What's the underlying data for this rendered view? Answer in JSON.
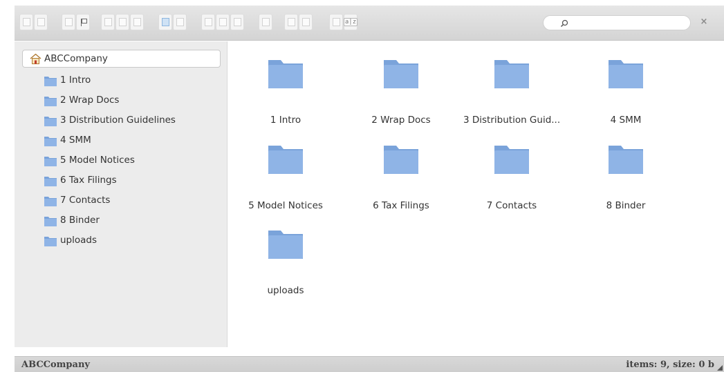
{
  "toolbar": {
    "groups": [
      {
        "buttons": [
          "back-icon",
          "forward-icon"
        ]
      },
      {
        "buttons": [
          "home-nav-icon",
          "up-folder-icon"
        ]
      },
      {
        "buttons": [
          "new-folder-icon",
          "new-file-icon",
          "upload-icon"
        ]
      },
      {
        "buttons": [
          "open-icon",
          "reload-icon"
        ]
      },
      {
        "buttons": [
          "copy-icon",
          "cut-icon",
          "paste-icon"
        ]
      },
      {
        "buttons": [
          "delete-icon"
        ]
      },
      {
        "buttons": [
          "rename-icon",
          "edit-icon"
        ]
      },
      {
        "buttons": [
          "view-icon",
          "sort-icon"
        ]
      }
    ],
    "sort_label": "a|z",
    "search": {
      "placeholder": "",
      "value": ""
    },
    "close_label": "×"
  },
  "sidebar": {
    "root": {
      "label": "ABCCompany",
      "icon": "home-icon"
    },
    "items": [
      {
        "label": "1 Intro"
      },
      {
        "label": "2 Wrap Docs"
      },
      {
        "label": "3 Distribution Guidelines"
      },
      {
        "label": "4 SMM"
      },
      {
        "label": "5 Model Notices"
      },
      {
        "label": "6 Tax Filings"
      },
      {
        "label": "7 Contacts"
      },
      {
        "label": "8 Binder"
      },
      {
        "label": "uploads"
      }
    ]
  },
  "main": {
    "items": [
      {
        "label": "1 Intro"
      },
      {
        "label": "2 Wrap Docs"
      },
      {
        "label": "3 Distribution Guid..."
      },
      {
        "label": "4 SMM"
      },
      {
        "label": "5 Model Notices"
      },
      {
        "label": "6 Tax Filings"
      },
      {
        "label": "7 Contacts"
      },
      {
        "label": "8 Binder"
      },
      {
        "label": "uploads"
      }
    ]
  },
  "statusbar": {
    "path": "ABCCompany",
    "info": "items: 9, size: 0 b"
  },
  "colors": {
    "folder_fill": "#8fb4e6",
    "folder_tab": "#7aa3da",
    "toolbar_bg": "#dcdcdc",
    "sidebar_bg": "#ececec",
    "status_bg": "#d4d4d4"
  }
}
